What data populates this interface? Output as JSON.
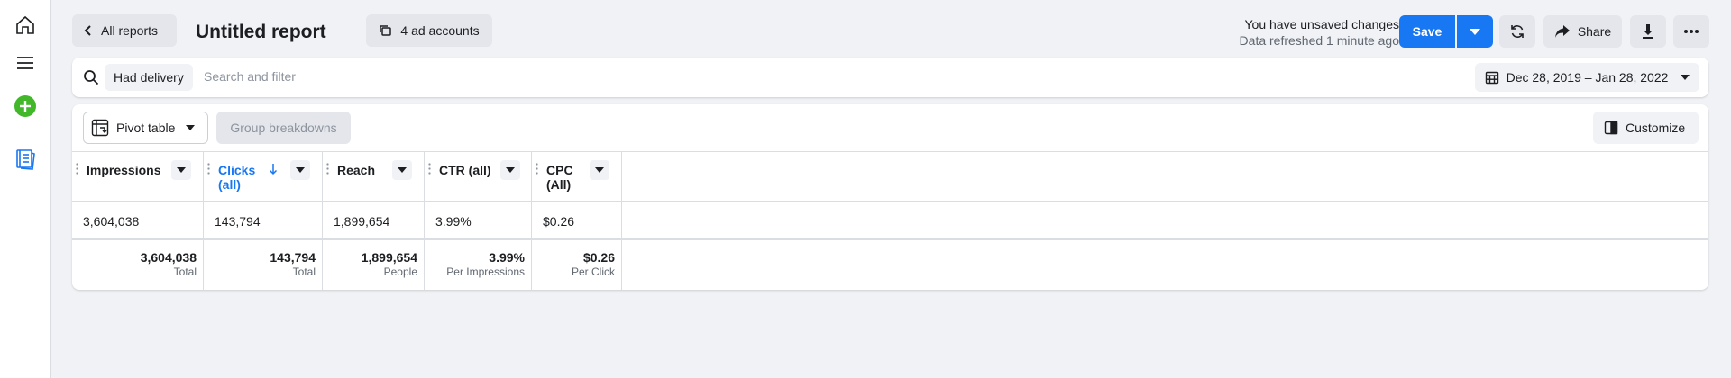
{
  "topbar": {
    "back_label": "All reports",
    "title": "Untitled report",
    "accounts_label": "4 ad accounts",
    "unsaved_text": "You have unsaved changes",
    "refreshed_text": "Data refreshed 1 minute ago",
    "save_label": "Save",
    "share_label": "Share"
  },
  "filter": {
    "chip_label": "Had delivery",
    "placeholder": "Search and filter",
    "date_range": "Dec 28, 2019 – Jan 28, 2022"
  },
  "toolbar": {
    "pivot_label": "Pivot table",
    "group_label": "Group breakdowns",
    "customize_label": "Customize"
  },
  "table": {
    "columns": [
      {
        "label": "Impressions",
        "sorted": false
      },
      {
        "label": "Clicks (all)",
        "sorted": true
      },
      {
        "label": "Reach",
        "sorted": false
      },
      {
        "label": "CTR (all)",
        "sorted": false
      },
      {
        "label": "CPC (All)",
        "sorted": false
      }
    ],
    "row": [
      "3,604,038",
      "143,794",
      "1,899,654",
      "3.99%",
      "$0.26"
    ],
    "totals": [
      {
        "value": "3,604,038",
        "label": "Total"
      },
      {
        "value": "143,794",
        "label": "Total"
      },
      {
        "value": "1,899,654",
        "label": "People"
      },
      {
        "value": "3.99%",
        "label": "Per Impressions"
      },
      {
        "value": "$0.26",
        "label": "Per Click"
      }
    ]
  },
  "colors": {
    "accent": "#1877f2",
    "add": "#42b72a",
    "sorted_header": "#1877f2"
  }
}
